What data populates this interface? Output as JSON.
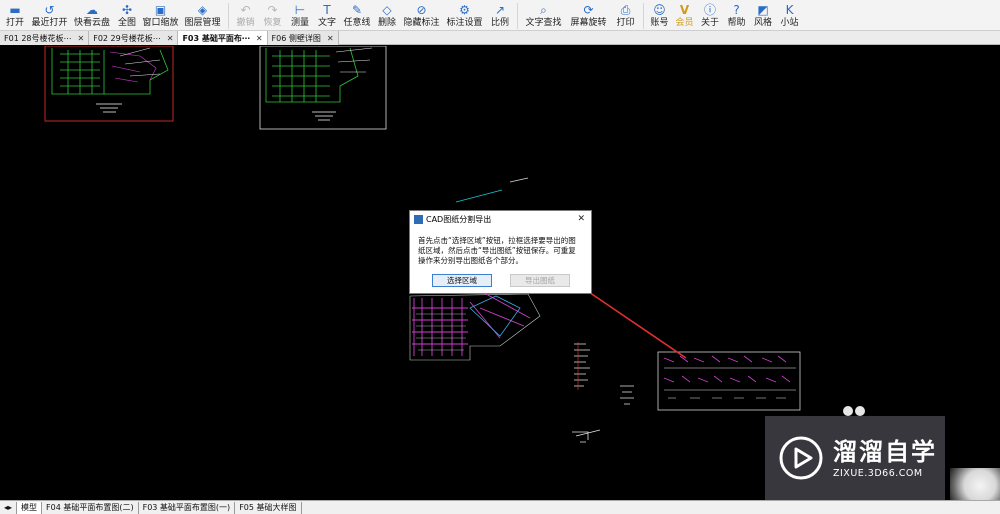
{
  "toolbar": {
    "items": [
      {
        "label": "打开",
        "icon": "folder-open-icon",
        "glyph": "▬"
      },
      {
        "label": "最近打开",
        "icon": "history-icon",
        "glyph": "↺"
      },
      {
        "label": "快看云盘",
        "icon": "cloud-icon",
        "glyph": "☁"
      },
      {
        "label": "全图",
        "icon": "fit-all-icon",
        "glyph": "✣"
      },
      {
        "label": "窗口缩放",
        "icon": "window-zoom-icon",
        "glyph": "▣"
      },
      {
        "label": "图层管理",
        "icon": "layers-icon",
        "glyph": "◈"
      },
      {
        "label": "撤销",
        "icon": "undo-icon",
        "glyph": "↶"
      },
      {
        "label": "恢复",
        "icon": "redo-icon",
        "glyph": "↷"
      },
      {
        "label": "测量",
        "icon": "measure-icon",
        "glyph": "⊢"
      },
      {
        "label": "文字",
        "icon": "text-icon",
        "glyph": "T"
      },
      {
        "label": "任意线",
        "icon": "pencil-icon",
        "glyph": "✎"
      },
      {
        "label": "删除",
        "icon": "eraser-icon",
        "glyph": "◇"
      },
      {
        "label": "隐藏标注",
        "icon": "hide-annotation-icon",
        "glyph": "⊘"
      },
      {
        "label": "标注设置",
        "icon": "annotation-settings-icon",
        "glyph": "⚙"
      },
      {
        "label": "比例",
        "icon": "scale-icon",
        "glyph": "↗"
      },
      {
        "label": "文字查找",
        "icon": "find-text-icon",
        "glyph": "⌕"
      },
      {
        "label": "屏幕旋转",
        "icon": "rotate-screen-icon",
        "glyph": "⟳"
      },
      {
        "label": "打印",
        "icon": "printer-icon",
        "glyph": "⎙"
      },
      {
        "label": "账号",
        "icon": "user-icon",
        "glyph": "☺"
      },
      {
        "label": "会员",
        "icon": "vip-icon",
        "glyph": "V"
      },
      {
        "label": "关于",
        "icon": "info-icon",
        "glyph": "ⓘ"
      },
      {
        "label": "帮助",
        "icon": "help-icon",
        "glyph": "?"
      },
      {
        "label": "风格",
        "icon": "style-icon",
        "glyph": "◩"
      },
      {
        "label": "小站",
        "icon": "station-icon",
        "glyph": "K"
      }
    ]
  },
  "tabs": [
    {
      "label": "F01 28号楼花板⋯"
    },
    {
      "label": "F02 29号楼花板⋯"
    },
    {
      "label": "F03 基础平面布⋯"
    },
    {
      "label": "F06 侧壁详图"
    }
  ],
  "tab_close_glyph": "✕",
  "dialog": {
    "title": "CAD图纸分割导出",
    "close_glyph": "✕",
    "description": "首先点击“选择区域”按钮，拉框选择要导出的图纸区域，然后点击“导出图纸”按钮保存。可重复操作来分别导出图纸各个部分。",
    "select_area_label": "选择区域",
    "export_label": "导出图纸"
  },
  "layout_tabs": {
    "arrows": "◂▸",
    "items": [
      "模型",
      "F04 基础平面布置图(二)",
      "F03 基础平面布置图(一)",
      "F05 基础大样图"
    ]
  },
  "watermark": {
    "name_cn": "溜溜自学",
    "url": "ZIXUE.3D66.COM"
  },
  "colors": {
    "canvas": "#000000",
    "annotation_arrow": "#e03030",
    "accent_blue": "#2b6cc4"
  }
}
